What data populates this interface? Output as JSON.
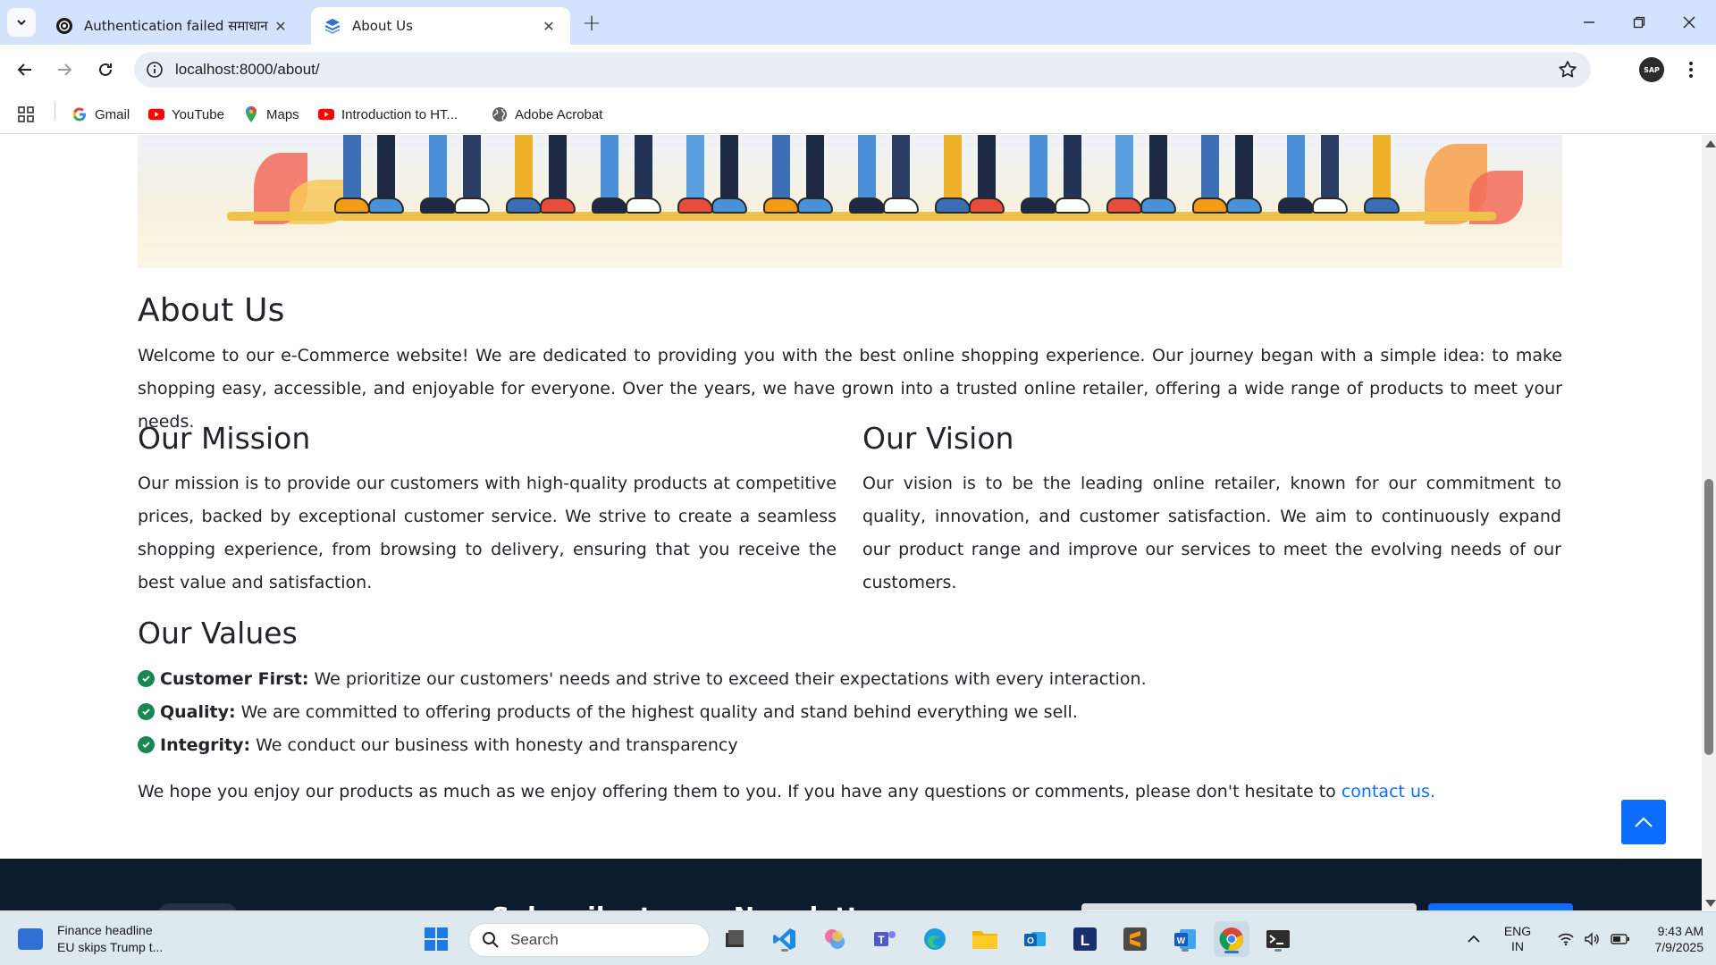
{
  "browser": {
    "tabs": [
      {
        "title": "Authentication failed समाधान",
        "active": false
      },
      {
        "title": "About Us",
        "active": true
      }
    ],
    "url": "localhost:8000/about/",
    "profile_label": "SAP",
    "bookmarks": [
      {
        "label": "Gmail",
        "icon": "google-icon"
      },
      {
        "label": "YouTube",
        "icon": "youtube-icon"
      },
      {
        "label": "Maps",
        "icon": "maps-icon"
      },
      {
        "label": "Introduction to HT...",
        "icon": "youtube-icon"
      },
      {
        "label": "Adobe Acrobat",
        "icon": "globe-icon"
      }
    ]
  },
  "page": {
    "heading": "About Us",
    "intro": "Welcome to our e-Commerce website! We are dedicated to providing you with the best online shopping experience. Our journey began with a simple idea: to make shopping easy, accessible, and enjoyable for everyone. Over the years, we have grown into a trusted online retailer, offering a wide range of products to meet your needs.",
    "mission": {
      "title": "Our Mission",
      "text": "Our mission is to provide our customers with high-quality products at competitive prices, backed by exceptional customer service. We strive to create a seamless shopping experience, from browsing to delivery, ensuring that you receive the best value and satisfaction."
    },
    "vision": {
      "title": "Our Vision",
      "text": "Our vision is to be the leading online retailer, known for our commitment to quality, innovation, and customer satisfaction. We aim to continuously expand our product range and improve our services to meet the evolving needs of our customers."
    },
    "values": {
      "title": "Our Values",
      "items": [
        {
          "label": "Customer First:",
          "text": "We prioritize our customers' needs and strive to exceed their expectations with every interaction."
        },
        {
          "label": "Quality:",
          "text": "We are committed to offering products of the highest quality and stand behind everything we sell."
        },
        {
          "label": "Integrity:",
          "text": "We conduct our business with honesty and transparency"
        }
      ]
    },
    "closing": {
      "text": "We hope you enjoy our products as much as we enjoy offering them to you. If you have any questions or comments, please don't hesitate to ",
      "link": "contact us."
    },
    "footer": {
      "newsletter_heading": "Subscribe to our Newsletter"
    }
  },
  "taskbar": {
    "widget": {
      "title": "Finance headline",
      "subtitle": "EU skips Trump t..."
    },
    "search_placeholder": "Search",
    "language": {
      "top": "ENG",
      "bottom": "IN"
    },
    "time": "9:43 AM",
    "date": "7/9/2025"
  },
  "colors": {
    "tab_strip": "#d3e3fd",
    "accent": "#0d6efd",
    "check": "#198754",
    "footer": "#0c1b2d"
  }
}
